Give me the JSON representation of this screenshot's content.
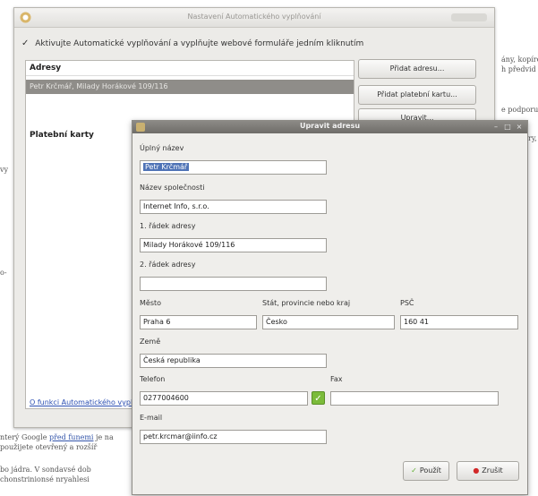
{
  "background_page": {
    "right_lines": [
      "ány, kopírov",
      "h předvid",
      "e podporu",
      "ry,",
      "vy",
      "o-"
    ],
    "left_lines": [
      "nterý Google",
      "je na",
      "použijete otevřený a rozšíř",
      "bo jádra. V sondavsé dob",
      "chonstrinionsé nryahlesi"
    ],
    "left_link": "před funemi"
  },
  "outer_window": {
    "title": "Nastavení Automatického vyplňování",
    "enable_label": "Aktivujte Automatické vyplňování a vyplňujte webové formuláře jedním kliknutím",
    "addresses_header": "Adresy",
    "address_entry": "Petr Krčmář, Milady Horákové 109/116",
    "cards_header": "Platební karty",
    "help_link": "O funkci Automatického vyplňování",
    "buttons": {
      "add_address": "Přidat adresu...",
      "add_card": "Přidat platební kartu...",
      "edit": "Upravit..."
    }
  },
  "edit_dialog": {
    "title": "Upravit adresu",
    "fields": {
      "full_name": {
        "label": "Úplný název",
        "value": "Petr Krčmář"
      },
      "company": {
        "label": "Název společnosti",
        "value": "Internet Info, s.r.o."
      },
      "address1": {
        "label": "1. řádek adresy",
        "value": "Milady Horákové 109/116"
      },
      "address2": {
        "label": "2. řádek adresy",
        "value": ""
      },
      "city": {
        "label": "Město",
        "value": "Praha 6"
      },
      "state": {
        "label": "Stát, provincie nebo kraj",
        "value": "Česko"
      },
      "zip": {
        "label": "PSČ",
        "value": "160 41"
      },
      "country": {
        "label": "Země",
        "value": "Česká republika"
      },
      "phone": {
        "label": "Telefon",
        "value": "0277004600"
      },
      "fax": {
        "label": "Fax",
        "value": ""
      },
      "email": {
        "label": "E-mail",
        "value": "petr.krcmar@iinfo.cz"
      }
    },
    "buttons": {
      "apply": "Použít",
      "cancel": "Zrušit"
    },
    "colors": {
      "apply_icon": "#5fae2e",
      "cancel_icon": "#d22828",
      "selection": "#4f73b6"
    }
  }
}
